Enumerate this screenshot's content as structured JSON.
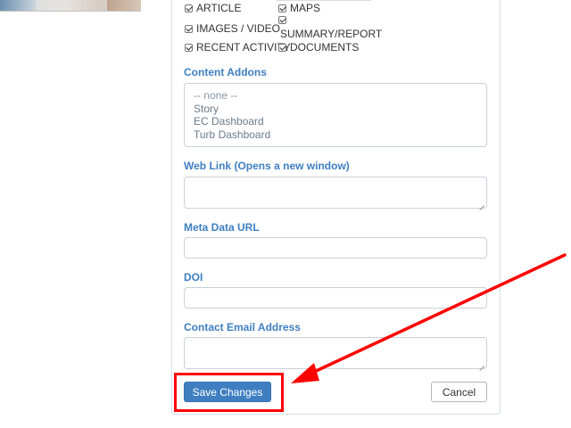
{
  "content_types": [
    {
      "label": "ARTICLE",
      "checked": true
    },
    {
      "label": "MAPS",
      "checked": true
    },
    {
      "label": "IMAGES / VIDEO",
      "checked": true
    },
    {
      "label": "SUMMARY/REPORT",
      "checked": true
    },
    {
      "label": "RECENT ACTIVITY",
      "checked": true
    },
    {
      "label": "DOCUMENTS",
      "checked": true
    }
  ],
  "content_addons": {
    "label": "Content Addons",
    "options": [
      "-- none --",
      "Story",
      "EC Dashboard",
      "Turb Dashboard"
    ]
  },
  "web_link": {
    "label": "Web Link (Opens a new window)",
    "value": ""
  },
  "meta_data_url": {
    "label": "Meta Data URL",
    "value": ""
  },
  "doi": {
    "label": "DOI",
    "value": ""
  },
  "contact_email": {
    "label": "Contact Email Address",
    "value": ""
  },
  "actions": {
    "save_label": "Save Changes",
    "cancel_label": "Cancel"
  },
  "annotation": {
    "highlight_color": "#ff0000",
    "points_to": "save-button"
  }
}
